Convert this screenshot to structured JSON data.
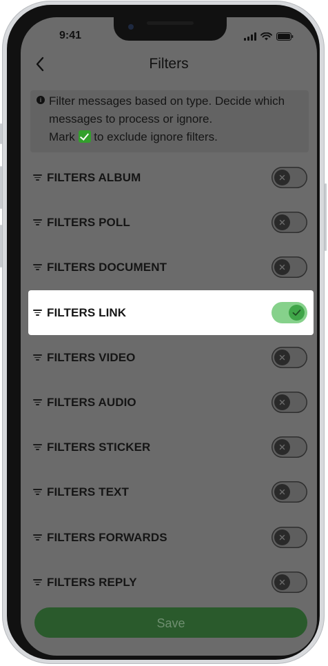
{
  "status_bar": {
    "time": "9:41"
  },
  "header": {
    "title": "Filters",
    "back_icon": "chevron-left-icon"
  },
  "info": {
    "icon": "info-icon",
    "line1": "Filter messages based on type. Decide which",
    "line2": "messages to process or ignore.",
    "line3_prefix": "Mark",
    "line3_suffix": "to exclude ignore filters."
  },
  "filters": [
    {
      "label": "FILTERS ALBUM",
      "enabled": false
    },
    {
      "label": "FILTERS POLL",
      "enabled": false
    },
    {
      "label": "FILTERS DOCUMENT",
      "enabled": false
    },
    {
      "label": "FILTERS LINK",
      "enabled": true
    },
    {
      "label": "FILTERS VIDEO",
      "enabled": false
    },
    {
      "label": "FILTERS AUDIO",
      "enabled": false
    },
    {
      "label": "FILTERS STICKER",
      "enabled": false
    },
    {
      "label": "FILTERS TEXT",
      "enabled": false
    },
    {
      "label": "FILTERS FORWARDS",
      "enabled": false
    },
    {
      "label": "FILTERS REPLY",
      "enabled": false
    }
  ],
  "footer": {
    "save_label": "Save"
  },
  "colors": {
    "overlay": "#6b6b6b",
    "toggle_on_track": "#86d18b",
    "toggle_on_knob": "#3fa548",
    "save_button": "#2a5a2c"
  }
}
